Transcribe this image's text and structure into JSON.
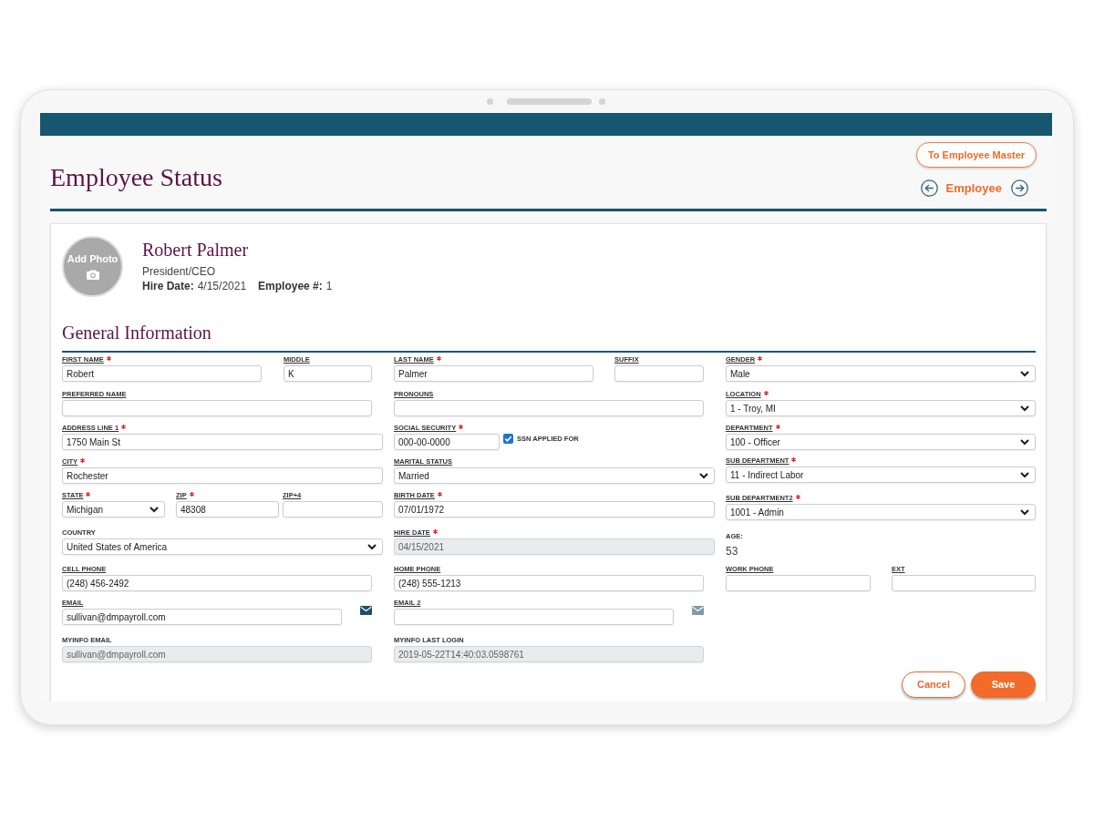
{
  "header": {
    "title": "Employee Status",
    "master_button": "To Employee Master",
    "nav_label": "Employee"
  },
  "profile": {
    "photo_label": "Add Photo",
    "name": "Robert Palmer",
    "job_title": "President/CEO",
    "details": [
      {
        "label": "Hire Date:",
        "value": "4/15/2021"
      },
      {
        "label": "Employee #:",
        "value": "1"
      }
    ]
  },
  "section": {
    "title": "General Information",
    "columns": [
      {
        "rows": [
          {
            "fields": [
              {
                "kind": "text",
                "label": "FIRST NAME",
                "link": true,
                "required": true,
                "disabled": false,
                "value": "Robert"
              },
              {
                "kind": "text",
                "label": "MIDDLE",
                "link": true,
                "required": false,
                "disabled": false,
                "value": "K"
              }
            ]
          },
          {
            "fields": [
              {
                "kind": "text",
                "label": "PREFERRED NAME",
                "link": true,
                "required": false,
                "disabled": false
              }
            ]
          },
          {
            "fields": [
              {
                "kind": "text",
                "label": "ADDRESS LINE 1",
                "link": true,
                "required": true,
                "disabled": false,
                "value": "1750 Main St"
              }
            ]
          },
          {
            "fields": [
              {
                "kind": "text",
                "label": "CITY",
                "link": true,
                "required": true,
                "disabled": false,
                "value": "Rochester"
              }
            ]
          },
          {
            "fields": [
              {
                "kind": "select",
                "label": "STATE",
                "link": true,
                "required": true,
                "disabled": false,
                "value": "Michigan"
              },
              {
                "kind": "text",
                "label": "ZIP",
                "link": true,
                "required": true,
                "disabled": false,
                "value": "48308"
              },
              {
                "kind": "text",
                "label": "ZIP+4",
                "link": true,
                "required": false,
                "disabled": false
              }
            ]
          },
          {
            "fields": [
              {
                "kind": "select",
                "label": "COUNTRY",
                "link": false,
                "required": false,
                "disabled": false,
                "value": "United States of America"
              }
            ]
          },
          {
            "fields": [
              {
                "kind": "text",
                "label": "CELL PHONE",
                "link": true,
                "required": false,
                "disabled": false,
                "value": "(248) 456-2492"
              }
            ]
          },
          {
            "fields": [
              {
                "kind": "email",
                "label": "EMAIL",
                "link": true,
                "required": false,
                "disabled": false,
                "value": "sullivan@dmpayroll.com",
                "mail_disabled": false
              }
            ]
          },
          {
            "fields": [
              {
                "kind": "text",
                "label": "MYINFO EMAIL",
                "link": false,
                "required": false,
                "disabled": true,
                "value": "sullivan@dmpayroll.com"
              }
            ]
          }
        ]
      },
      {
        "rows": [
          {
            "fields": [
              {
                "kind": "text",
                "label": "LAST NAME",
                "link": true,
                "required": true,
                "disabled": false,
                "value": "Palmer"
              },
              {
                "kind": "text",
                "label": "SUFFIX",
                "link": true,
                "required": false,
                "disabled": false
              }
            ]
          },
          {
            "fields": [
              {
                "kind": "text",
                "label": "PRONOUNS",
                "link": true,
                "required": false,
                "disabled": false
              }
            ]
          },
          {
            "fields": [
              {
                "kind": "text",
                "label": "SOCIAL SECURITY",
                "link": true,
                "required": true,
                "disabled": false,
                "value": "000-00-0000"
              },
              {
                "kind": "checkbox",
                "label": "SSN APPLIED FOR",
                "link": false,
                "required": false,
                "disabled": false,
                "checked": true
              }
            ]
          },
          {
            "fields": [
              {
                "kind": "select",
                "label": "MARITAL STATUS",
                "link": true,
                "required": false,
                "disabled": false,
                "value": "Married"
              }
            ]
          },
          {
            "fields": [
              {
                "kind": "text",
                "label": "BIRTH DATE",
                "link": true,
                "required": true,
                "disabled": false,
                "value": "07/01/1972"
              }
            ]
          },
          {
            "fields": [
              {
                "kind": "text",
                "label": "HIRE DATE",
                "link": true,
                "required": true,
                "disabled": true,
                "value": "04/15/2021"
              }
            ]
          },
          {
            "fields": [
              {
                "kind": "text",
                "label": "HOME PHONE",
                "link": true,
                "required": false,
                "disabled": false,
                "value": "(248) 555-1213"
              }
            ]
          },
          {
            "fields": [
              {
                "kind": "email",
                "label": "EMAIL 2",
                "link": true,
                "required": false,
                "disabled": false,
                "mail_disabled": true
              }
            ]
          },
          {
            "fields": [
              {
                "kind": "text",
                "label": "MYINFO LAST LOGIN",
                "link": false,
                "required": false,
                "disabled": true,
                "value": "2019-05-22T14:40:03.0598761"
              }
            ]
          }
        ]
      },
      {
        "rows": [
          {
            "fields": [
              {
                "kind": "select",
                "label": "GENDER",
                "link": true,
                "required": true,
                "disabled": false,
                "value": "Male"
              }
            ]
          },
          {
            "fields": [
              {
                "kind": "select",
                "label": "LOCATION",
                "link": true,
                "required": true,
                "disabled": false,
                "value": "1 - Troy, MI"
              }
            ]
          },
          {
            "fields": [
              {
                "kind": "select",
                "label": "DEPARTMENT",
                "link": true,
                "required": true,
                "disabled": false,
                "value": "100 - Officer"
              }
            ]
          },
          {
            "fields": [
              {
                "kind": "select",
                "label": "SUB DEPARTMENT",
                "link": true,
                "required": true,
                "disabled": false,
                "value": "11 - Indirect Labor"
              }
            ]
          },
          {
            "fields": [
              {
                "kind": "select",
                "label": "SUB DEPARTMENT2",
                "link": true,
                "required": true,
                "disabled": false,
                "value": "1001 - Admin"
              }
            ]
          },
          {
            "fields": [
              {
                "kind": "readonly",
                "label": "AGE:",
                "link": false,
                "required": false,
                "disabled": false,
                "value": "53"
              }
            ]
          },
          {
            "fields": [
              {
                "kind": "text",
                "label": "WORK PHONE",
                "link": true,
                "required": false,
                "disabled": false
              },
              {
                "kind": "text",
                "label": "EXT",
                "link": true,
                "required": false,
                "disabled": false
              }
            ]
          }
        ]
      }
    ]
  },
  "actions": [
    {
      "label": "Cancel",
      "kind": "secondary"
    },
    {
      "label": "Save",
      "kind": "primary"
    }
  ]
}
